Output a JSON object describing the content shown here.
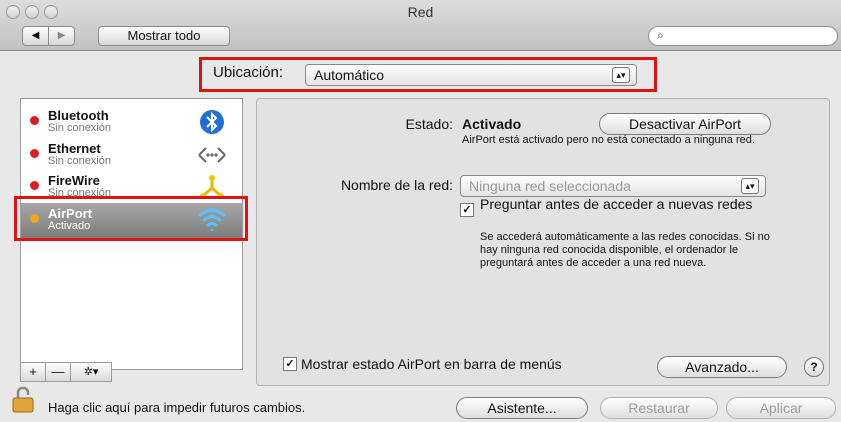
{
  "window": {
    "title": "Red"
  },
  "toolbar": {
    "back_label": "◀",
    "forward_label": "▶",
    "show_all_label": "Mostrar todo",
    "search_placeholder": ""
  },
  "location": {
    "label": "Ubicación:",
    "value": "Automático"
  },
  "services": [
    {
      "name": "Bluetooth",
      "status": "Sin conexión",
      "dot_color": "#d42020",
      "icon": "bluetooth-icon"
    },
    {
      "name": "Ethernet",
      "status": "Sin conexión",
      "dot_color": "#d42020",
      "icon": "ethernet-icon"
    },
    {
      "name": "FireWire",
      "status": "Sin conexión",
      "dot_color": "#d42020",
      "icon": "firewire-icon"
    },
    {
      "name": "AirPort",
      "status": "Activado",
      "dot_color": "#f2a516",
      "icon": "wifi-icon",
      "selected": true
    }
  ],
  "sidebar_buttons": {
    "add": "+",
    "remove": "—",
    "actions": "✲▾"
  },
  "main": {
    "status_label": "Estado:",
    "status_value": "Activado",
    "toggle_button": "Desactivar AirPort",
    "status_desc": "AirPort está activado pero no está conectado a ninguna red.",
    "network_label": "Nombre de la red:",
    "network_value": "Ninguna red seleccionada",
    "ask_checkbox_label": "Preguntar antes de acceder a nuevas redes",
    "ask_desc": "Se accederá automáticamente a las redes conocidas. Si no hay ninguna red conocida disponible, el ordenador le preguntará antes de acceder a una red nueva.",
    "show_status_label": "Mostrar estado AirPort en barra de menús",
    "advanced_button": "Avanzado...",
    "help": "?"
  },
  "footer": {
    "lock_text": "Haga clic aquí para impedir futuros cambios.",
    "assistant_button": "Asistente...",
    "revert_button": "Restaurar",
    "apply_button": "Aplicar"
  }
}
